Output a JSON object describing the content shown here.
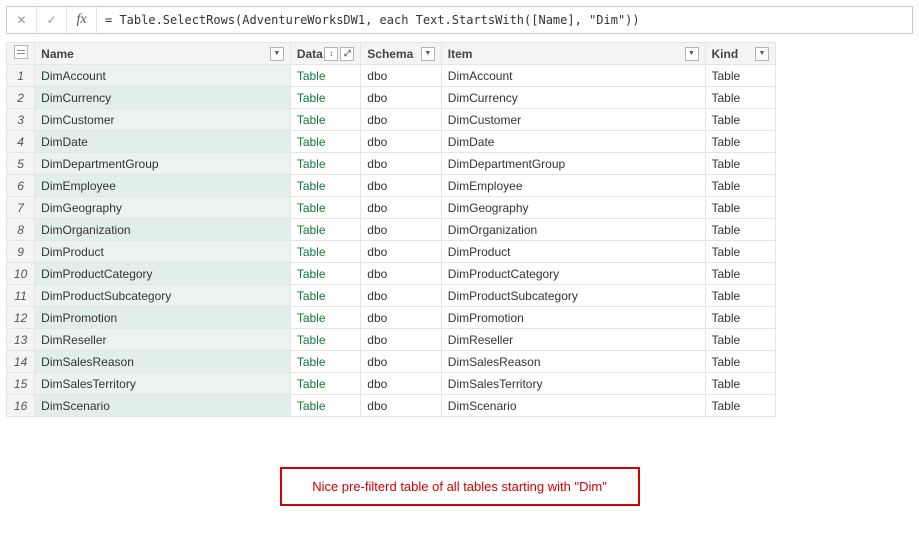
{
  "formula_bar": {
    "cancel": "✕",
    "confirm": "✓",
    "fx": "fx",
    "formula": "= Table.SelectRows(AdventureWorksDW1, each Text.StartsWith([Name], \"Dim\"))"
  },
  "columns": {
    "name": "Name",
    "data": "Data",
    "schema": "Schema",
    "item": "Item",
    "kind": "Kind"
  },
  "rows": [
    {
      "n": "1",
      "name": "DimAccount",
      "data": "Table",
      "schema": "dbo",
      "item": "DimAccount",
      "kind": "Table"
    },
    {
      "n": "2",
      "name": "DimCurrency",
      "data": "Table",
      "schema": "dbo",
      "item": "DimCurrency",
      "kind": "Table"
    },
    {
      "n": "3",
      "name": "DimCustomer",
      "data": "Table",
      "schema": "dbo",
      "item": "DimCustomer",
      "kind": "Table"
    },
    {
      "n": "4",
      "name": "DimDate",
      "data": "Table",
      "schema": "dbo",
      "item": "DimDate",
      "kind": "Table"
    },
    {
      "n": "5",
      "name": "DimDepartmentGroup",
      "data": "Table",
      "schema": "dbo",
      "item": "DimDepartmentGroup",
      "kind": "Table"
    },
    {
      "n": "6",
      "name": "DimEmployee",
      "data": "Table",
      "schema": "dbo",
      "item": "DimEmployee",
      "kind": "Table"
    },
    {
      "n": "7",
      "name": "DimGeography",
      "data": "Table",
      "schema": "dbo",
      "item": "DimGeography",
      "kind": "Table"
    },
    {
      "n": "8",
      "name": "DimOrganization",
      "data": "Table",
      "schema": "dbo",
      "item": "DimOrganization",
      "kind": "Table"
    },
    {
      "n": "9",
      "name": "DimProduct",
      "data": "Table",
      "schema": "dbo",
      "item": "DimProduct",
      "kind": "Table"
    },
    {
      "n": "10",
      "name": "DimProductCategory",
      "data": "Table",
      "schema": "dbo",
      "item": "DimProductCategory",
      "kind": "Table"
    },
    {
      "n": "11",
      "name": "DimProductSubcategory",
      "data": "Table",
      "schema": "dbo",
      "item": "DimProductSubcategory",
      "kind": "Table"
    },
    {
      "n": "12",
      "name": "DimPromotion",
      "data": "Table",
      "schema": "dbo",
      "item": "DimPromotion",
      "kind": "Table"
    },
    {
      "n": "13",
      "name": "DimReseller",
      "data": "Table",
      "schema": "dbo",
      "item": "DimReseller",
      "kind": "Table"
    },
    {
      "n": "14",
      "name": "DimSalesReason",
      "data": "Table",
      "schema": "dbo",
      "item": "DimSalesReason",
      "kind": "Table"
    },
    {
      "n": "15",
      "name": "DimSalesTerritory",
      "data": "Table",
      "schema": "dbo",
      "item": "DimSalesTerritory",
      "kind": "Table"
    },
    {
      "n": "16",
      "name": "DimScenario",
      "data": "Table",
      "schema": "dbo",
      "item": "DimScenario",
      "kind": "Table"
    }
  ],
  "callout": "Nice pre-filterd table of all tables starting with \"Dim\""
}
